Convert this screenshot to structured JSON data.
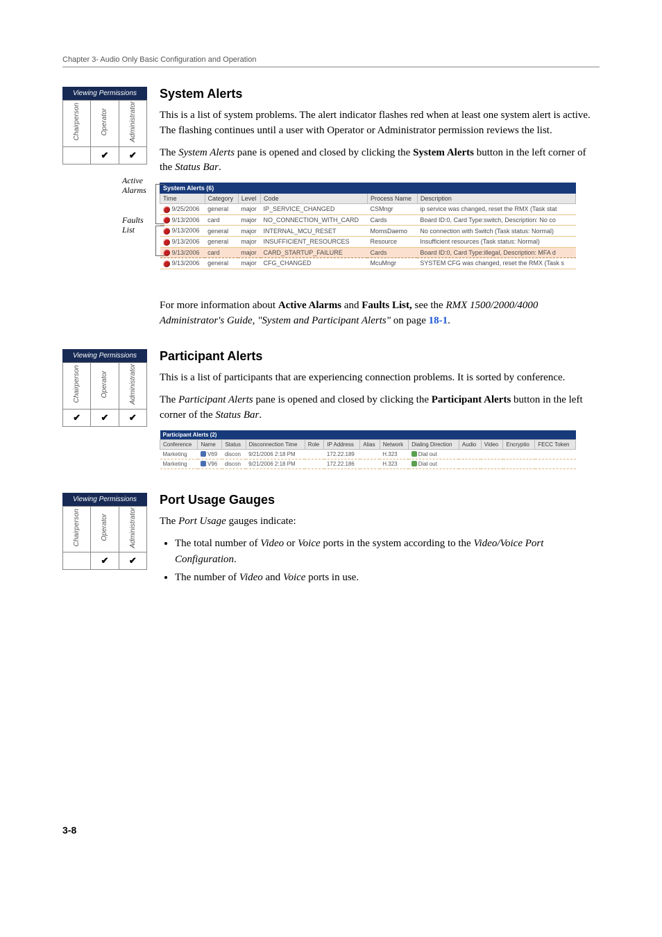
{
  "header": "Chapter 3- Audio Only Basic Configuration and Operation",
  "pageNumber": "3-8",
  "perms": {
    "title": "Viewing Permissions",
    "roles": [
      "Chairperson",
      "Operator",
      "Administrator"
    ]
  },
  "check": "✔",
  "sysAlerts": {
    "heading": "System Alerts",
    "p1a": "This is a list of system problems. The alert indicator flashes red when at least one system alert is active. The flashing continues until a user with Operator or Administrator permission reviews the list.",
    "p2_pre": "The ",
    "p2_em": "System Alerts",
    "p2_mid": " pane is opened and closed by clicking the ",
    "p2_b": "System Alerts",
    "p2_post": " button in the left corner of the ",
    "p2_em2": "Status Bar",
    "p2_end": ".",
    "sideTop": "Active\nAlarms",
    "sideBottom": "Faults\nList",
    "tableTitle": "System Alerts (6)",
    "headers": [
      "Time",
      "Category",
      "Level",
      "Code",
      "Process Name",
      "Description"
    ],
    "rows": [
      [
        "9/25/2006",
        "general",
        "major",
        "IP_SERVICE_CHANGED",
        "CSMngr",
        "ip service was changed, reset the RMX (Task stat"
      ],
      [
        "9/13/2006",
        "card",
        "major",
        "NO_CONNECTION_WITH_CARD",
        "Cards",
        "Board ID:0, Card Type:switch, Description: No co"
      ],
      [
        "9/13/2006",
        "general",
        "major",
        "INTERNAL_MCU_RESET",
        "MomsDaemo",
        "No connection with Switch (Task status: Normal)"
      ],
      [
        "9/13/2006",
        "general",
        "major",
        "INSUFFICIENT_RESOURCES",
        "Resource",
        "Insufficient resources (Task status: Normal)"
      ],
      [
        "9/13/2006",
        "card",
        "major",
        "CARD_STARTUP_FAILURE",
        "Cards",
        "Board ID:0, Card Type:illegal, Description: MFA d"
      ],
      [
        "9/13/2006",
        "general",
        "major",
        "CFG_CHANGED",
        "McuMngr",
        "SYSTEM CFG was changed, reset the RMX (Task s"
      ]
    ],
    "post_pre": "For more information about ",
    "post_b1": "Active Alarms",
    "post_and": " and ",
    "post_b2": "Faults List,",
    "post_mid": " see the ",
    "post_em": "RMX 1500/2000/4000 Administrator's Guide, \"System and Participant Alerts\"",
    "post_on": " on page ",
    "post_link": "18-1",
    "post_end": "."
  },
  "partAlerts": {
    "heading": "Participant Alerts",
    "p1": "This is a list of participants that are experiencing connection problems. It is sorted by conference.",
    "p2_pre": "The ",
    "p2_em": "Participant Alerts",
    "p2_mid": " pane is opened and closed by clicking the ",
    "p2_b": "Participant Alerts",
    "p2_post": " button in the left corner of the ",
    "p2_em2": "Status Bar",
    "p2_end": ".",
    "tableTitle": "Participant Alerts (2)",
    "headers": [
      "Conference",
      "Name",
      "Status",
      "Disconnection Time",
      "Role",
      "IP Address",
      "Alias",
      "Network",
      "Dialing Direction",
      "Audio",
      "Video",
      "Encryptio",
      "FECC Token"
    ],
    "rows": [
      [
        "Marketing",
        "V69",
        "discon",
        "9/21/2006 2:18 PM",
        "",
        "172.22.189",
        "",
        "H.323",
        "Dial out",
        "",
        "",
        "",
        ""
      ],
      [
        "Marketing",
        "V96",
        "discon",
        "9/21/2006 2:18 PM",
        "",
        "172.22.186",
        "",
        "H.323",
        "Dial out",
        "",
        "",
        "",
        ""
      ]
    ]
  },
  "portUsage": {
    "heading": "Port Usage Gauges",
    "intro_pre": "The ",
    "intro_em": "Port Usage",
    "intro_post": " gauges indicate:",
    "b1_pre": "The total number of ",
    "b1_em1": "Video",
    "b1_or": " or ",
    "b1_em2": "Voice",
    "b1_mid": " ports in the system according to the ",
    "b1_em3": "Video/Voice Port Configuration",
    "b1_end": ".",
    "b2_pre": "The number of ",
    "b2_em1": "Video",
    "b2_and": " and ",
    "b2_em2": "Voice",
    "b2_end": " ports in use."
  }
}
